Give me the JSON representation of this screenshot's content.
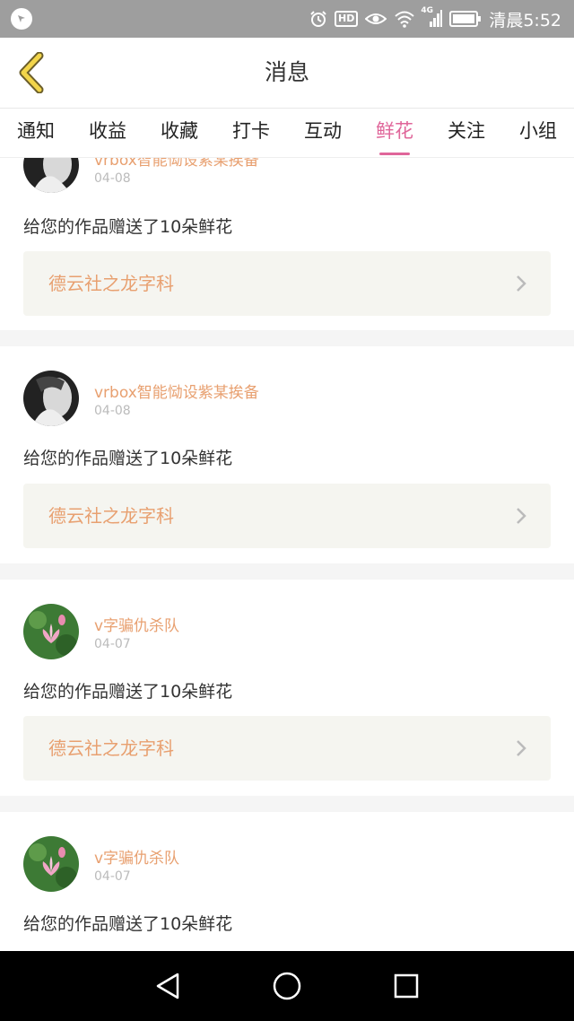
{
  "status_bar": {
    "time": "清晨5:52",
    "network": "4G",
    "hd": "HD",
    "icons": [
      "app-icon",
      "alarm-icon",
      "hd-icon",
      "eye-icon",
      "wifi-icon",
      "signal-icon",
      "battery-icon"
    ]
  },
  "header": {
    "title": "消息",
    "back_icon": "chevron-left-icon"
  },
  "tabs": [
    {
      "label": "通知",
      "active": false
    },
    {
      "label": "收益",
      "active": false
    },
    {
      "label": "收藏",
      "active": false
    },
    {
      "label": "打卡",
      "active": false
    },
    {
      "label": "互动",
      "active": false
    },
    {
      "label": "鲜花",
      "active": true
    },
    {
      "label": "关注",
      "active": false
    },
    {
      "label": "小组",
      "active": false
    }
  ],
  "messages": [
    {
      "user": "vrbox智能恸设紫某挨备",
      "date": "04-08",
      "text": "给您的作品赠送了10朵鲜花",
      "work": "德云社之龙字科",
      "avatar": "bw-portrait"
    },
    {
      "user": "vrbox智能恸设紫某挨备",
      "date": "04-08",
      "text": "给您的作品赠送了10朵鲜花",
      "work": "德云社之龙字科",
      "avatar": "bw-portrait"
    },
    {
      "user": "v字骗仇杀队",
      "date": "04-07",
      "text": "给您的作品赠送了10朵鲜花",
      "work": "德云社之龙字科",
      "avatar": "lotus"
    },
    {
      "user": "v字骗仇杀队",
      "date": "04-07",
      "text": "给您的作品赠送了10朵鲜花",
      "work": "",
      "avatar": "lotus"
    }
  ],
  "colors": {
    "accent": "#e0669a",
    "username": "#e8a070",
    "back_icon": "#f2d54a"
  },
  "nav_bar": [
    "back-triangle-icon",
    "home-circle-icon",
    "recents-square-icon"
  ]
}
